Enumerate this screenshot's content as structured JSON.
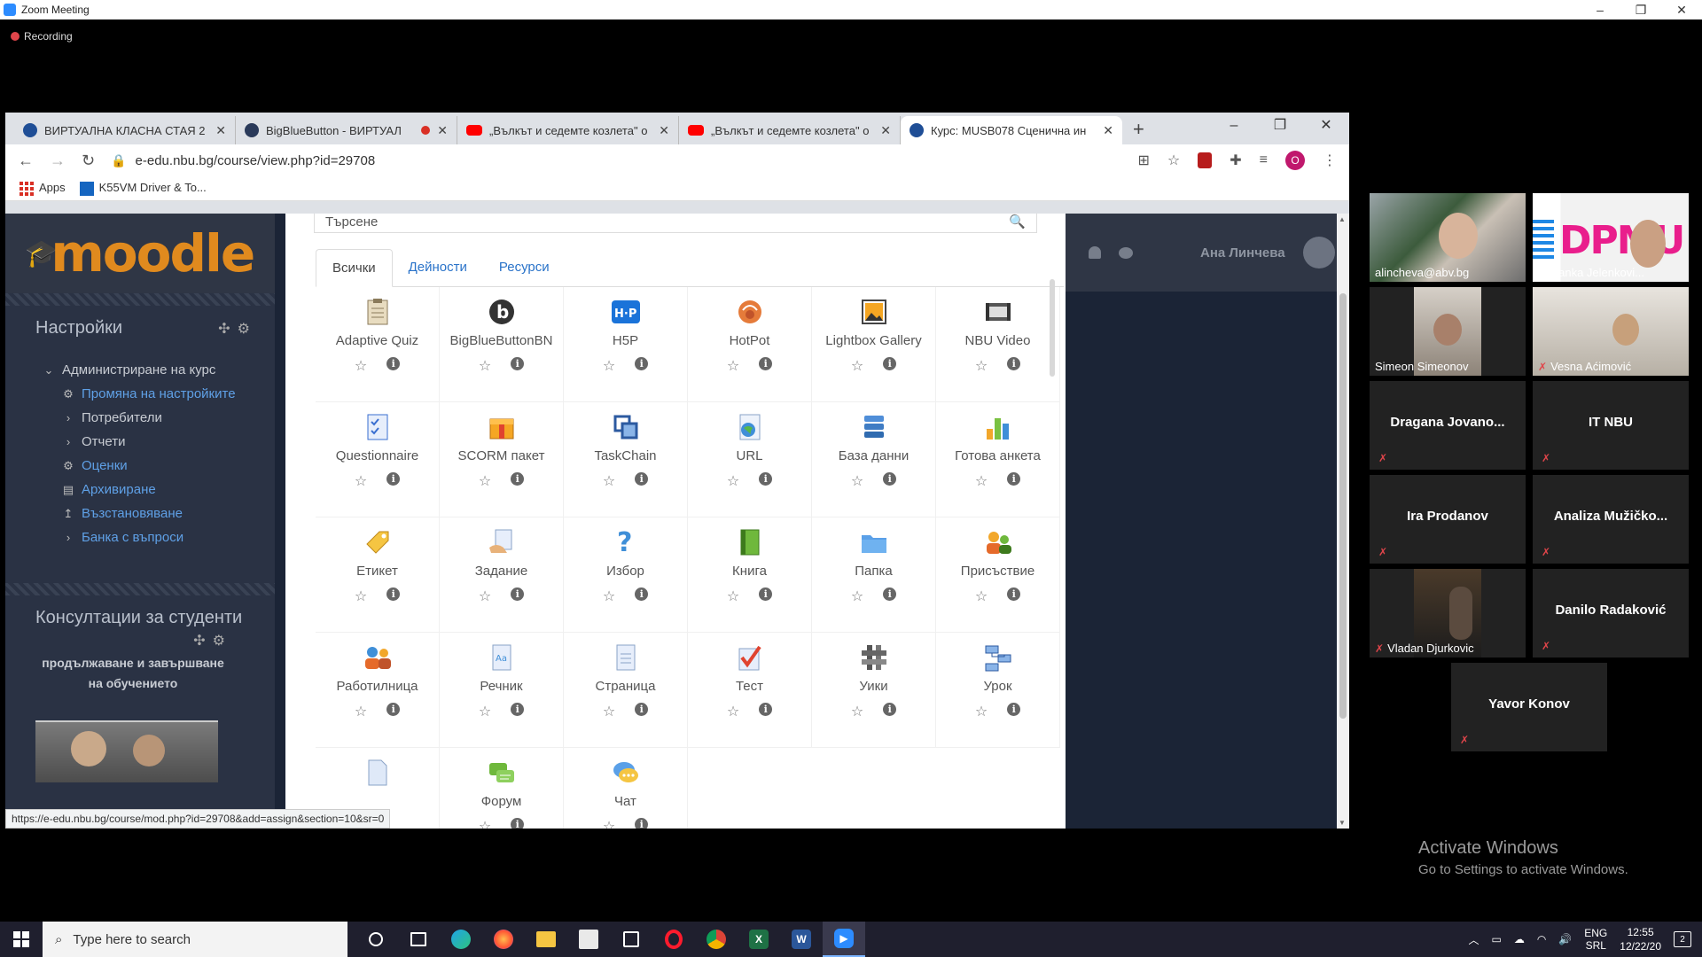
{
  "zoom": {
    "title": "Zoom Meeting",
    "recording_label": "Recording",
    "win_controls": [
      "–",
      "❐",
      "✕"
    ]
  },
  "browser": {
    "tabs": [
      {
        "label": "ВИРТУАЛНА КЛАСНА СТАЯ 2",
        "favicon": "moodle-favicon",
        "recording": false
      },
      {
        "label": "BigBlueButton - ВИРТУАЛ",
        "favicon": "bbb-favicon",
        "recording": true
      },
      {
        "label": "„Вълкът и седемте козлета\" о",
        "favicon": "youtube-favicon",
        "recording": false
      },
      {
        "label": "„Вълкът и седемте козлета\" о",
        "favicon": "youtube-favicon",
        "recording": false
      },
      {
        "label": "Курс: MUSB078 Сценична ин",
        "favicon": "moodle-favicon",
        "recording": false,
        "active": true
      }
    ],
    "new_tab": "+",
    "url": "e-edu.nbu.bg/course/view.php?id=29708",
    "profile_initial": "O",
    "bookmarks": [
      {
        "label": "Apps",
        "icon": "apps-grid-icon"
      },
      {
        "label": "K55VM Driver & To...",
        "icon": "asus-icon"
      }
    ],
    "status_url": "https://e-edu.nbu.bg/course/mod.php?id=29708&add=assign&section=10&sr=0"
  },
  "moodle": {
    "logo_text": "moodle",
    "settings_block": {
      "title": "Настройки",
      "items": [
        {
          "label": "Администриране на курс",
          "level": 1,
          "expanded": true,
          "link": false
        },
        {
          "label": "Промяна на настройките",
          "level": 2,
          "icon": "gear-icon",
          "link": true
        },
        {
          "label": "Потребители",
          "level": 2,
          "icon": "chevron-right-icon",
          "link": false
        },
        {
          "label": "Отчети",
          "level": 2,
          "icon": "chevron-right-icon",
          "link": false
        },
        {
          "label": "Оценки",
          "level": 2,
          "icon": "gear-icon",
          "link": true
        },
        {
          "label": "Архивиране",
          "level": 2,
          "icon": "file-icon",
          "link": true
        },
        {
          "label": "Възстановяване",
          "level": 2,
          "icon": "upload-icon",
          "link": true
        },
        {
          "label": "Банка с въпроси",
          "level": 2,
          "icon": "chevron-right-icon",
          "link": true
        }
      ]
    },
    "consult_block": {
      "title": "Консултации за студенти",
      "desc": "продължаване и завършване на обучението"
    },
    "user_name": "Ана Линчева",
    "chooser": {
      "search_placeholder": "Търсене",
      "tabs": [
        "Всички",
        "Дейности",
        "Ресурси"
      ],
      "modules": [
        {
          "label": "Adaptive Quiz",
          "icon": "adaptive-quiz-icon"
        },
        {
          "label": "BigBlueButtonBN",
          "icon": "bigbluebutton-icon"
        },
        {
          "label": "H5P",
          "icon": "h5p-icon"
        },
        {
          "label": "HotPot",
          "icon": "hotpot-icon"
        },
        {
          "label": "Lightbox Gallery",
          "icon": "gallery-icon"
        },
        {
          "label": "NBU Video",
          "icon": "video-icon"
        },
        {
          "label": "Questionnaire",
          "icon": "questionnaire-icon"
        },
        {
          "label": "SCORM пакет",
          "icon": "scorm-icon"
        },
        {
          "label": "TaskChain",
          "icon": "taskchain-icon"
        },
        {
          "label": "URL",
          "icon": "url-icon"
        },
        {
          "label": "База данни",
          "icon": "database-icon"
        },
        {
          "label": "Готова анкета",
          "icon": "survey-icon"
        },
        {
          "label": "Етикет",
          "icon": "label-icon"
        },
        {
          "label": "Задание",
          "icon": "assignment-icon"
        },
        {
          "label": "Избор",
          "icon": "choice-icon"
        },
        {
          "label": "Книга",
          "icon": "book-icon"
        },
        {
          "label": "Папка",
          "icon": "folder-icon"
        },
        {
          "label": "Присъствие",
          "icon": "attendance-icon"
        },
        {
          "label": "Работилница",
          "icon": "workshop-icon"
        },
        {
          "label": "Речник",
          "icon": "glossary-icon"
        },
        {
          "label": "Страница",
          "icon": "page-icon"
        },
        {
          "label": "Тест",
          "icon": "quiz-icon"
        },
        {
          "label": "Уики",
          "icon": "wiki-icon"
        },
        {
          "label": "Урок",
          "icon": "lesson-icon"
        },
        {
          "label": "",
          "icon": "file-resource-icon"
        },
        {
          "label": "Форум",
          "icon": "forum-icon"
        },
        {
          "label": "Чат",
          "icon": "chat-icon"
        }
      ]
    }
  },
  "participants": [
    {
      "name": "alincheva@abv.bg",
      "video": "v1",
      "speaking": true,
      "muted": false
    },
    {
      "name": "Dušanka Jelenkovi...",
      "video": "v2",
      "speaking": false,
      "muted": false
    },
    {
      "name": "Simeon Simeonov",
      "video": "v3",
      "speaking": false,
      "muted": false
    },
    {
      "name": "Vesna Aćimović",
      "video": "v4",
      "speaking": false,
      "muted": true
    },
    {
      "name": "Dragana Jovano...",
      "video": "",
      "speaking": false,
      "muted": true
    },
    {
      "name": "IT NBU",
      "video": "",
      "speaking": false,
      "muted": true
    },
    {
      "name": "Ira Prodanov",
      "video": "",
      "speaking": false,
      "muted": true
    },
    {
      "name": "Analiza Mužičko...",
      "video": "",
      "speaking": false,
      "muted": true
    },
    {
      "name": "Vladan Djurkovic",
      "video": "v5",
      "speaking": false,
      "muted": true
    },
    {
      "name": "Danilo Radaković",
      "video": "",
      "speaking": false,
      "muted": true
    },
    {
      "name": "Yavor Konov",
      "video": "",
      "speaking": false,
      "muted": true
    }
  ],
  "activate": {
    "line1": "Activate Windows",
    "line2": "Go to Settings to activate Windows."
  },
  "taskbar": {
    "search_placeholder": "Type here to search",
    "apps": [
      "cortana",
      "taskview",
      "edge",
      "firefox",
      "folder",
      "store",
      "tablet",
      "opera",
      "chrome",
      "excel",
      "word",
      "zoom"
    ],
    "lang1": "ENG",
    "lang2": "SRL",
    "time": "12:55",
    "date": "12/22/20",
    "notifications": "2"
  }
}
